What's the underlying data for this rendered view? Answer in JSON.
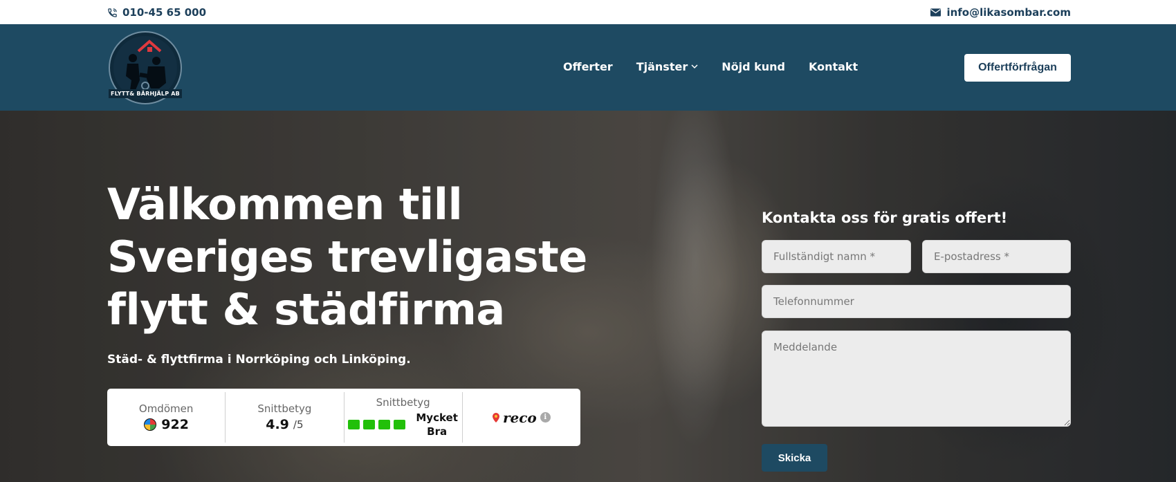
{
  "topbar": {
    "phone": "010-45 65 000",
    "email": "info@likasombar.com"
  },
  "header": {
    "logo_text": "FLYTT& BÄRHJÄLP AB",
    "nav": [
      {
        "label": "Offerter"
      },
      {
        "label": "Tjänster"
      },
      {
        "label": "Nöjd kund"
      },
      {
        "label": "Kontakt"
      }
    ],
    "cta_label": "Offertförfrågan"
  },
  "hero": {
    "title_line1": "Välkommen till",
    "title_line2": "Sveriges trevligaste",
    "title_line3": "flytt & städfirma",
    "subtitle": "Städ- & flyttfirma i Norrköping och Linköping."
  },
  "rating": {
    "reviews_label": "Omdömen",
    "reviews_count": "922",
    "avg_label": "Snittbetyg",
    "avg_value": "4.9",
    "avg_scale": "/5",
    "grade_label": "Snittbetyg",
    "grade_bars": 4,
    "grade_text_line1": "Mycket",
    "grade_text_line2": "Bra",
    "brand": "reco",
    "bar_color": "#22c00a"
  },
  "form": {
    "title": "Kontakta oss för gratis offert!",
    "name_placeholder": "Fullständigt namn *",
    "email_placeholder": "E-postadress *",
    "phone_placeholder": "Telefonnummer",
    "message_placeholder": "Meddelande",
    "submit_label": "Skicka"
  },
  "colors": {
    "brand_dark": "#1e4a62",
    "text_dark": "#1c3f5a"
  }
}
